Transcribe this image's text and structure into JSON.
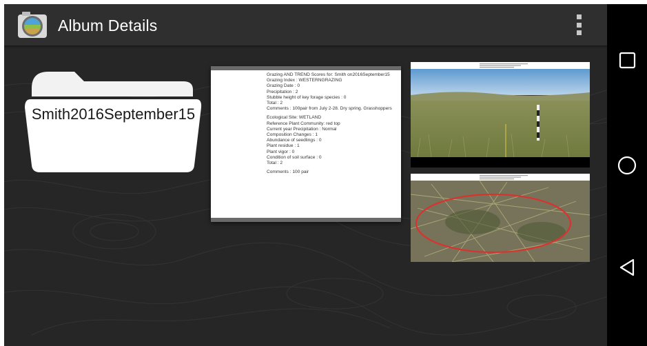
{
  "app_bar": {
    "title": "Album Details",
    "icon": "camera-landscape-icon",
    "overflow_icon": "more-vert-icon"
  },
  "folder": {
    "label": "Smith2016September15",
    "icon": "folder-icon"
  },
  "report_card": {
    "lines_1": [
      "Grazing AND TREND Scores for: Smith  on2016September15",
      "Grazing Index : WESTERNGRAZING",
      "Grazing Date : 0",
      "Precipitation : 2",
      "Stubble height of key forage species : 0",
      "Total : 2",
      "Comments : 100pair from July 2-28.  Dry spring.  Grasshoppers"
    ],
    "lines_2": [
      "Ecological Site: WETLAND",
      "Reference Plant Community: red top",
      "Current year Precipitation : Normal",
      "Composition Changes : 1",
      "Abundance of seedlings : 0",
      "Plant residue : 1",
      "Plant vigor : 0",
      "Condition of soil surface : 0",
      "Total : 2"
    ],
    "lines_3": [
      "Comments : 100 pair"
    ]
  },
  "photos": [
    {
      "name": "prairie-landscape-photo",
      "subject": "grassland horizon with marker pole"
    },
    {
      "name": "ground-plot-photo",
      "subject": "red hoop on grass ground plot"
    }
  ],
  "nav_bar": {
    "recents_icon": "square-recents-icon",
    "home_icon": "circle-home-icon",
    "back_icon": "triangle-back-icon"
  },
  "colors": {
    "app_background": "#262626",
    "app_bar": "#2f2f2f",
    "nav_bar": "#000000",
    "folder_fill": "#ffffff"
  }
}
